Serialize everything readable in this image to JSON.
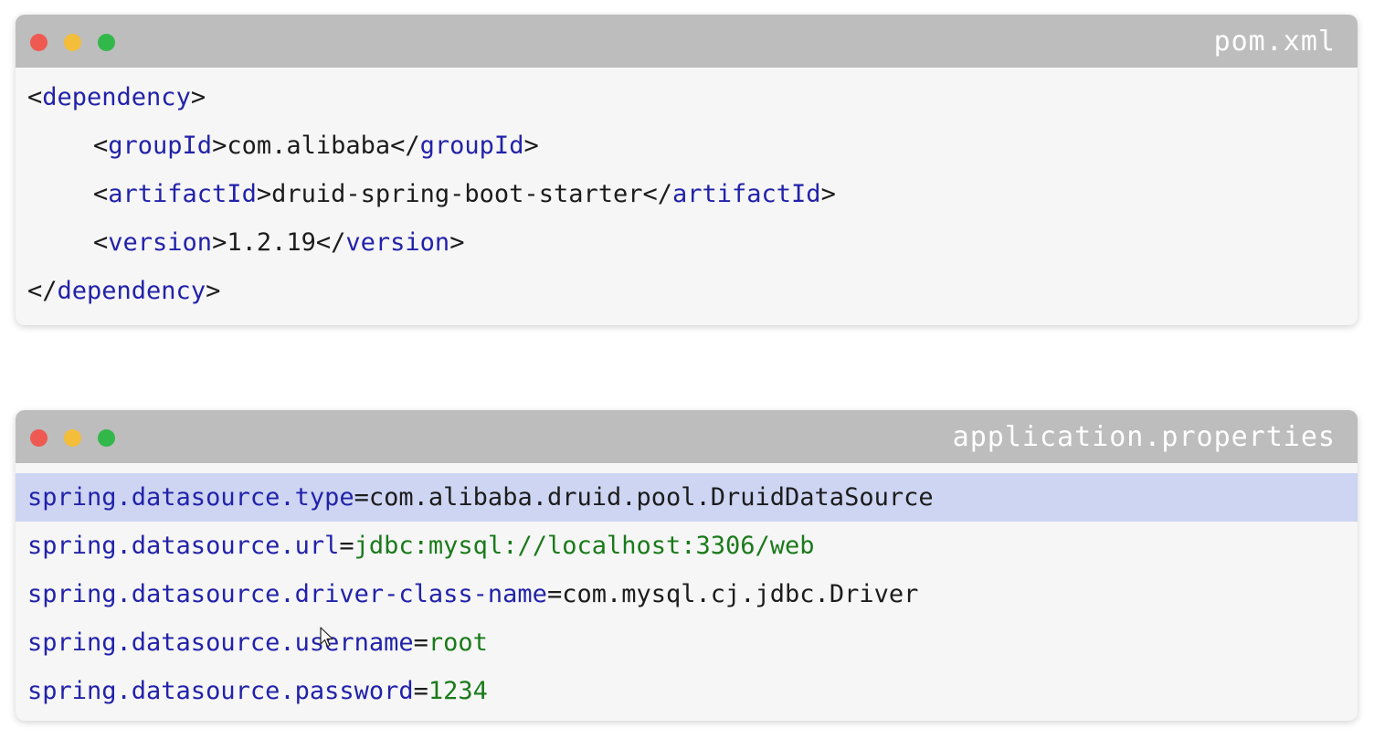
{
  "windows": [
    {
      "filename": "pom.xml",
      "lines": [
        {
          "open": "<",
          "tag": "dependency",
          "close": ">"
        },
        {
          "lt": "<",
          "tag1": "groupId",
          "gt": ">",
          "text": "com.alibaba",
          "lt2": "</",
          "tag2": "groupId",
          "gt2": ">"
        },
        {
          "lt": "<",
          "tag1": "artifactId",
          "gt": ">",
          "text": "druid-spring-boot-starter",
          "lt2": "</",
          "tag2": "artifactId",
          "gt2": ">"
        },
        {
          "lt": "<",
          "tag1": "version",
          "gt": ">",
          "text": "1.2.19",
          "lt2": "</",
          "tag2": "version",
          "gt2": ">"
        },
        {
          "open": "</",
          "tag": "dependency",
          "close": ">"
        }
      ]
    },
    {
      "filename": "application.properties",
      "lines": [
        {
          "key": "spring.datasource.type",
          "eq": "=",
          "value": "com.alibaba.druid.pool.DruidDataSource"
        },
        {
          "key": "spring.datasource.url",
          "eq": "=",
          "value": "jdbc:mysql://localhost:3306/web"
        },
        {
          "key": "spring.datasource.driver-class-name",
          "eq": "=",
          "value": "com.mysql.cj.jdbc.Driver"
        },
        {
          "key": "spring.datasource.username",
          "eq": "=",
          "value": "root"
        },
        {
          "key": "spring.datasource.password",
          "eq": "=",
          "value": "1234"
        }
      ]
    }
  ],
  "colors": {
    "titlebar": "#bdbdbd",
    "tag": "#2222aa",
    "string_value": "#1a7a1a",
    "highlight": "#cdd5f3",
    "close_dot": "#ee5a51",
    "minimize_dot": "#f4bd3a",
    "maximize_dot": "#32b84a"
  },
  "icons": [
    "close-icon",
    "minimize-icon",
    "maximize-icon",
    "mouse-cursor-icon"
  ]
}
